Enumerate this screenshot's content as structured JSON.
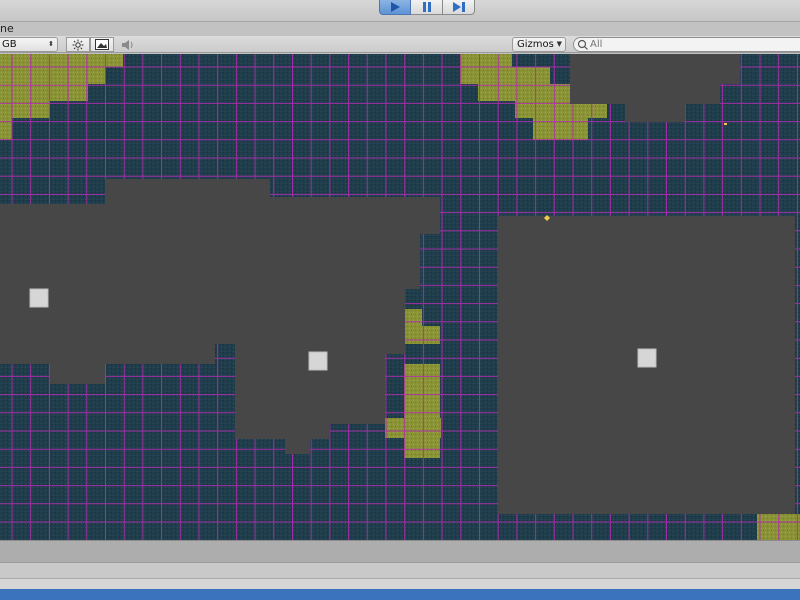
{
  "toolbar": {
    "play_icon": "play-icon",
    "pause_icon": "pause-icon",
    "step_icon": "step-icon",
    "accent": "#5e93d4"
  },
  "scene_view": {
    "tab_label_fragment": "ne",
    "render_mode": "GB",
    "gizmos_label": "Gizmos",
    "search_placeholder": "All"
  },
  "colors": {
    "floor": "#474747",
    "wall_tile": "#1f3d4a",
    "moss_tile": "#8a9335",
    "grid_line": "#b02db0",
    "cube": "#d6d6d6",
    "marker": "#f2c94c"
  }
}
